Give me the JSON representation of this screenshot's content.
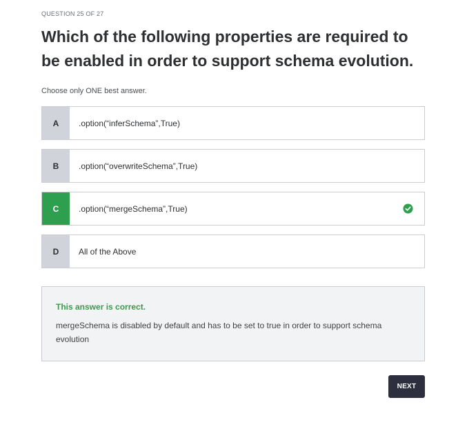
{
  "quiz": {
    "counter": "QUESTION 25 OF 27",
    "question": "Which of the following properties are required to be enabled in order to support schema evolution.",
    "instruction": "Choose only ONE best answer.",
    "options": [
      {
        "letter": "A",
        "text": ".option(“inferSchema”,True)"
      },
      {
        "letter": "B",
        "text": ".option(“overwriteSchema”,True)"
      },
      {
        "letter": "C",
        "text": ".option(“mergeSchema”,True)",
        "selected": true,
        "correct": true
      },
      {
        "letter": "D",
        "text": "All of the Above"
      }
    ]
  },
  "feedback": {
    "status": "This answer is correct.",
    "explanation": "mergeSchema is disabled by default and has to be set to true in order to support schema evolution"
  },
  "actions": {
    "next_label": "NEXT"
  },
  "colors": {
    "correct_green": "#2e9e4f",
    "letter_gray": "#d1d3da",
    "button_dark": "#2d2f3f"
  },
  "icons": {
    "correct_option": "check-circle-icon"
  }
}
